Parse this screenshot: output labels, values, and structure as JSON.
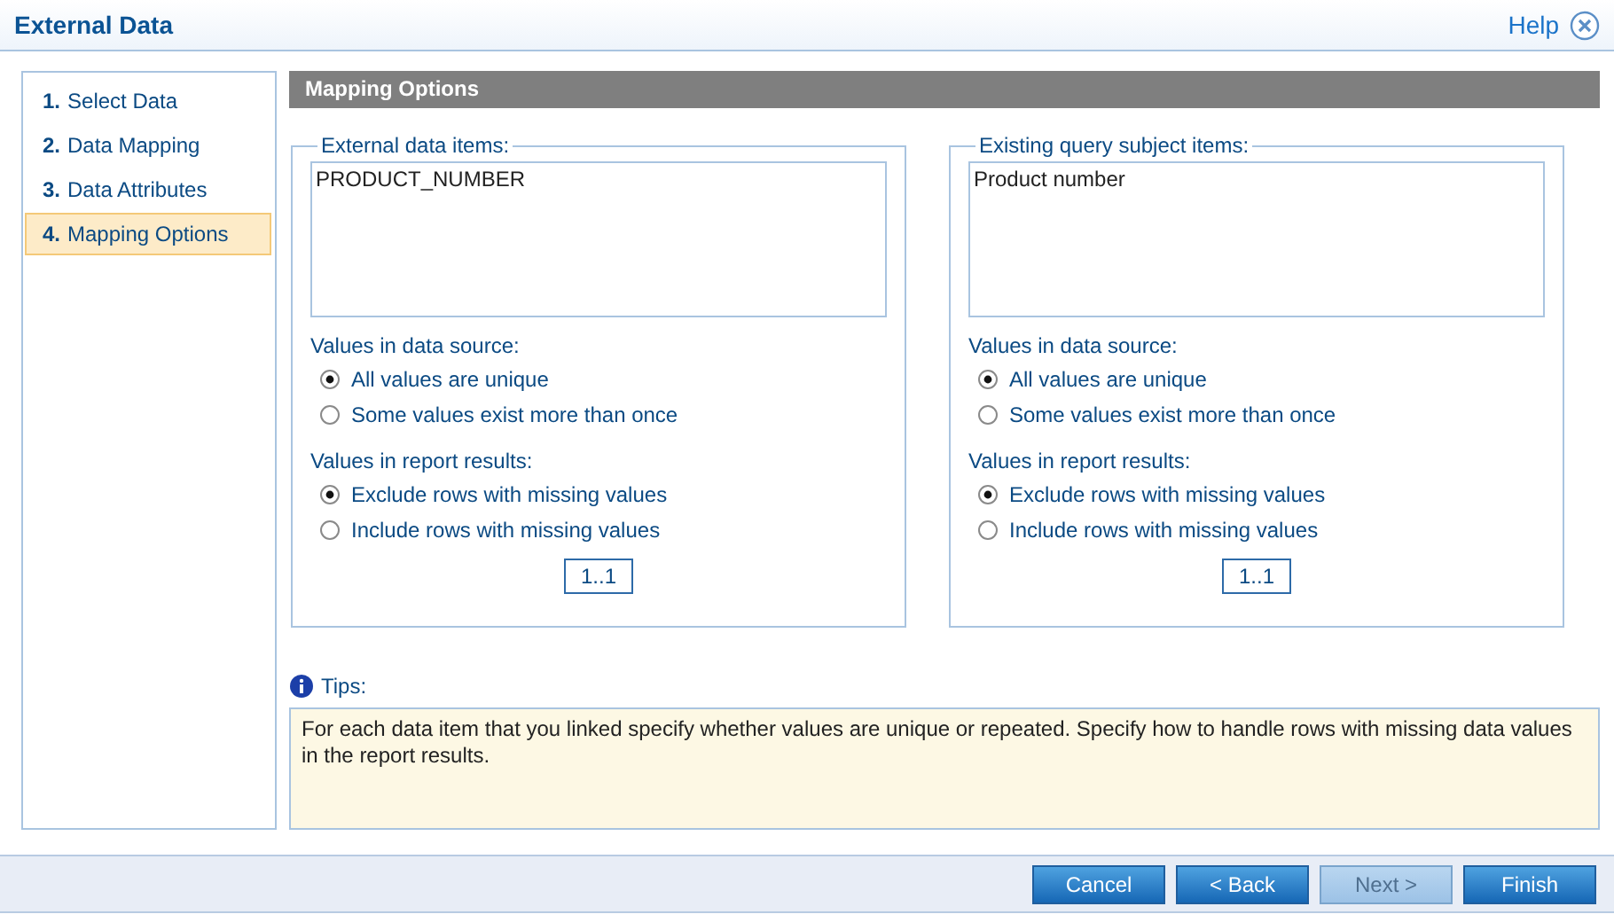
{
  "window": {
    "title": "External Data",
    "help": "Help"
  },
  "steps": [
    {
      "number": "1.",
      "label": "Select Data",
      "selected": false
    },
    {
      "number": "2.",
      "label": "Data Mapping",
      "selected": false
    },
    {
      "number": "3.",
      "label": "Data Attributes",
      "selected": false
    },
    {
      "number": "4.",
      "label": "Mapping Options",
      "selected": true
    }
  ],
  "section_title": "Mapping Options",
  "panels": [
    {
      "legend": "External data items:",
      "items": [
        "PRODUCT_NUMBER"
      ],
      "groups": [
        {
          "label": "Values in data source:",
          "options": [
            {
              "label": "All values are unique",
              "selected": true
            },
            {
              "label": "Some values exist more than once",
              "selected": false
            }
          ]
        },
        {
          "label": "Values in report results:",
          "options": [
            {
              "label": "Exclude rows with missing values",
              "selected": true
            },
            {
              "label": "Include rows with missing values",
              "selected": false
            }
          ]
        }
      ],
      "cardinality": "1..1"
    },
    {
      "legend": "Existing query subject items:",
      "items": [
        "Product number"
      ],
      "groups": [
        {
          "label": "Values in data source:",
          "options": [
            {
              "label": "All values are unique",
              "selected": true
            },
            {
              "label": "Some values exist more than once",
              "selected": false
            }
          ]
        },
        {
          "label": "Values in report results:",
          "options": [
            {
              "label": "Exclude rows with missing values",
              "selected": true
            },
            {
              "label": "Include rows with missing values",
              "selected": false
            }
          ]
        }
      ],
      "cardinality": "1..1"
    }
  ],
  "tips": {
    "title": "Tips:",
    "text": "For each data item that you linked specify whether values are unique or repeated. Specify how to handle rows with missing data values in the report results."
  },
  "buttons": [
    {
      "label": "Cancel",
      "disabled": false
    },
    {
      "label": "< Back",
      "disabled": false
    },
    {
      "label": "Next >",
      "disabled": true
    },
    {
      "label": "Finish",
      "disabled": false
    }
  ]
}
